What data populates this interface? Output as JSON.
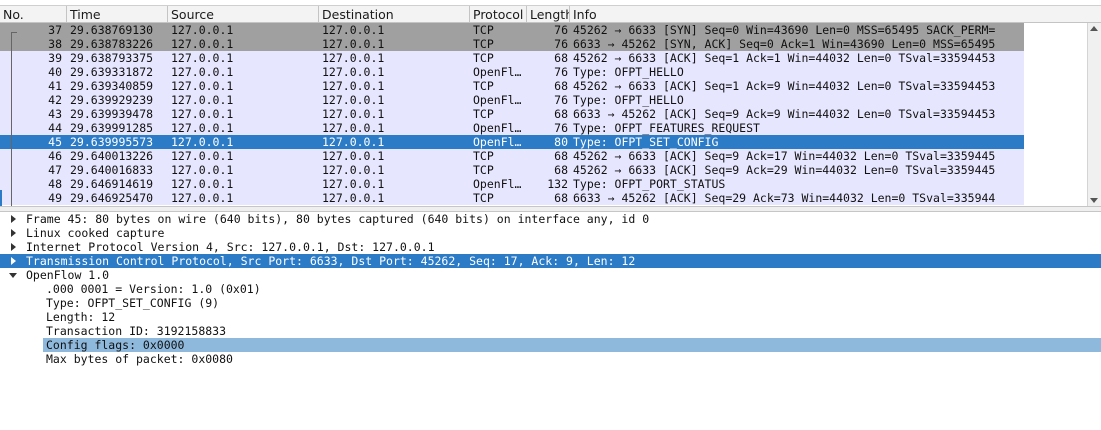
{
  "packet_list": {
    "columns": [
      "No.",
      "Time",
      "Source",
      "Destination",
      "Protocol",
      "Length",
      "Info"
    ],
    "rows": [
      {
        "no": "37",
        "time": "29.638769130",
        "src": "127.0.0.1",
        "dst": "127.0.0.1",
        "proto": "TCP",
        "len": "76",
        "info": "45262 → 6633 [SYN] Seq=0 Win=43690 Len=0 MSS=65495 SACK_PERM=",
        "style": "syn"
      },
      {
        "no": "38",
        "time": "29.638783226",
        "src": "127.0.0.1",
        "dst": "127.0.0.1",
        "proto": "TCP",
        "len": "76",
        "info": "6633 → 45262 [SYN, ACK] Seq=0 Ack=1 Win=43690 Len=0 MSS=65495",
        "style": "syn"
      },
      {
        "no": "39",
        "time": "29.638793375",
        "src": "127.0.0.1",
        "dst": "127.0.0.1",
        "proto": "TCP",
        "len": "68",
        "info": "45262 → 6633 [ACK] Seq=1 Ack=1 Win=44032 Len=0 TSval=33594453",
        "style": "tcp"
      },
      {
        "no": "40",
        "time": "29.639331872",
        "src": "127.0.0.1",
        "dst": "127.0.0.1",
        "proto": "OpenFl…",
        "len": "76",
        "info": "Type: OFPT_HELLO",
        "style": "tcp"
      },
      {
        "no": "41",
        "time": "29.639340859",
        "src": "127.0.0.1",
        "dst": "127.0.0.1",
        "proto": "TCP",
        "len": "68",
        "info": "45262 → 6633 [ACK] Seq=1 Ack=9 Win=44032 Len=0 TSval=33594453",
        "style": "tcp"
      },
      {
        "no": "42",
        "time": "29.639929239",
        "src": "127.0.0.1",
        "dst": "127.0.0.1",
        "proto": "OpenFl…",
        "len": "76",
        "info": "Type: OFPT_HELLO",
        "style": "tcp"
      },
      {
        "no": "43",
        "time": "29.639939478",
        "src": "127.0.0.1",
        "dst": "127.0.0.1",
        "proto": "TCP",
        "len": "68",
        "info": "6633 → 45262 [ACK] Seq=9 Ack=9 Win=44032 Len=0 TSval=33594453",
        "style": "tcp"
      },
      {
        "no": "44",
        "time": "29.639991285",
        "src": "127.0.0.1",
        "dst": "127.0.0.1",
        "proto": "OpenFl…",
        "len": "76",
        "info": "Type: OFPT_FEATURES_REQUEST",
        "style": "tcp"
      },
      {
        "no": "45",
        "time": "29.639995573",
        "src": "127.0.0.1",
        "dst": "127.0.0.1",
        "proto": "OpenFl…",
        "len": "80",
        "info": "Type: OFPT_SET_CONFIG",
        "style": "sel"
      },
      {
        "no": "46",
        "time": "29.640013226",
        "src": "127.0.0.1",
        "dst": "127.0.0.1",
        "proto": "TCP",
        "len": "68",
        "info": "45262 → 6633 [ACK] Seq=9 Ack=17 Win=44032 Len=0 TSval=3359445",
        "style": "tcp"
      },
      {
        "no": "47",
        "time": "29.640016833",
        "src": "127.0.0.1",
        "dst": "127.0.0.1",
        "proto": "TCP",
        "len": "68",
        "info": "45262 → 6633 [ACK] Seq=9 Ack=29 Win=44032 Len=0 TSval=3359445",
        "style": "tcp"
      },
      {
        "no": "48",
        "time": "29.646914619",
        "src": "127.0.0.1",
        "dst": "127.0.0.1",
        "proto": "OpenFl…",
        "len": "132",
        "info": "Type: OFPT_PORT_STATUS",
        "style": "tcp"
      },
      {
        "no": "49",
        "time": "29.646925470",
        "src": "127.0.0.1",
        "dst": "127.0.0.1",
        "proto": "TCP",
        "len": "68",
        "info": "6633 → 45262 [ACK] Seq=29 Ack=73 Win=44032 Len=0 TSval=335944",
        "style": "tcp"
      }
    ]
  },
  "details": [
    {
      "level": 0,
      "expander": "collapsed",
      "text": "Frame 45: 80 bytes on wire (640 bits), 80 bytes captured (640 bits) on interface any, id 0",
      "state": ""
    },
    {
      "level": 0,
      "expander": "collapsed",
      "text": "Linux cooked capture",
      "state": ""
    },
    {
      "level": 0,
      "expander": "collapsed",
      "text": "Internet Protocol Version 4, Src: 127.0.0.1, Dst: 127.0.0.1",
      "state": ""
    },
    {
      "level": 0,
      "expander": "collapsed",
      "text": "Transmission Control Protocol, Src Port: 6633, Dst Port: 45262, Seq: 17, Ack: 9, Len: 12",
      "state": "sel"
    },
    {
      "level": 0,
      "expander": "expanded",
      "text": "OpenFlow 1.0",
      "state": ""
    },
    {
      "level": 1,
      "expander": "none",
      "text": ".000 0001 = Version: 1.0 (0x01)",
      "state": ""
    },
    {
      "level": 1,
      "expander": "none",
      "text": "Type: OFPT_SET_CONFIG (9)",
      "state": ""
    },
    {
      "level": 1,
      "expander": "none",
      "text": "Length: 12",
      "state": ""
    },
    {
      "level": 1,
      "expander": "none",
      "text": "Transaction ID: 3192158833",
      "state": ""
    },
    {
      "level": 1,
      "expander": "none",
      "text": "Config flags: 0x0000",
      "state": "hl"
    },
    {
      "level": 1,
      "expander": "none",
      "text": "Max bytes of packet: 0x0080",
      "state": ""
    }
  ],
  "icons": {
    "collapsed": "tree-collapsed-icon",
    "expanded": "tree-expanded-icon"
  },
  "colors": {
    "selected": "#2b7bc6",
    "tcp_row": "#e7e6ff",
    "syn_row": "#a0a0a0",
    "field_highlight": "#8fb9dc"
  }
}
